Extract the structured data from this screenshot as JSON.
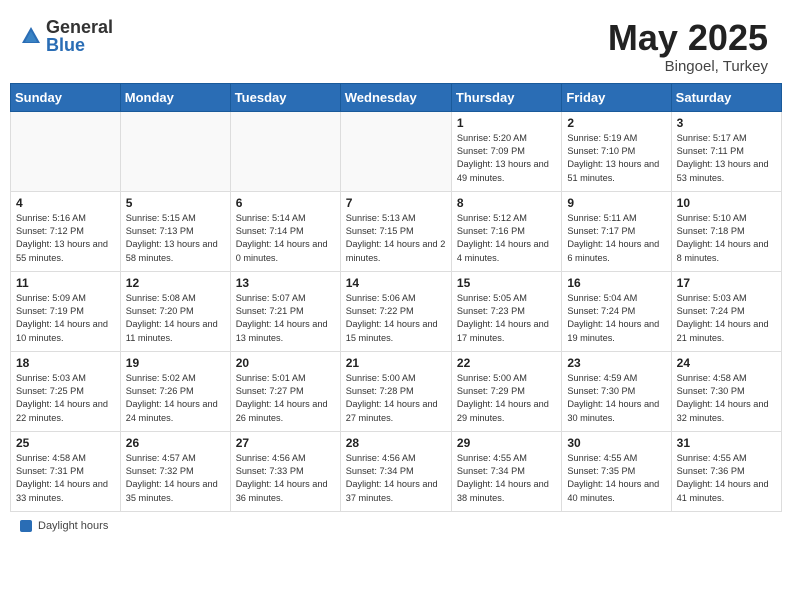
{
  "header": {
    "logo_general": "General",
    "logo_blue": "Blue",
    "month": "May 2025",
    "location": "Bingoel, Turkey"
  },
  "footer": {
    "label": "Daylight hours"
  },
  "days_of_week": [
    "Sunday",
    "Monday",
    "Tuesday",
    "Wednesday",
    "Thursday",
    "Friday",
    "Saturday"
  ],
  "weeks": [
    [
      {
        "num": "",
        "sunrise": "",
        "sunset": "",
        "daylight": ""
      },
      {
        "num": "",
        "sunrise": "",
        "sunset": "",
        "daylight": ""
      },
      {
        "num": "",
        "sunrise": "",
        "sunset": "",
        "daylight": ""
      },
      {
        "num": "",
        "sunrise": "",
        "sunset": "",
        "daylight": ""
      },
      {
        "num": "1",
        "sunrise": "Sunrise: 5:20 AM",
        "sunset": "Sunset: 7:09 PM",
        "daylight": "Daylight: 13 hours and 49 minutes."
      },
      {
        "num": "2",
        "sunrise": "Sunrise: 5:19 AM",
        "sunset": "Sunset: 7:10 PM",
        "daylight": "Daylight: 13 hours and 51 minutes."
      },
      {
        "num": "3",
        "sunrise": "Sunrise: 5:17 AM",
        "sunset": "Sunset: 7:11 PM",
        "daylight": "Daylight: 13 hours and 53 minutes."
      }
    ],
    [
      {
        "num": "4",
        "sunrise": "Sunrise: 5:16 AM",
        "sunset": "Sunset: 7:12 PM",
        "daylight": "Daylight: 13 hours and 55 minutes."
      },
      {
        "num": "5",
        "sunrise": "Sunrise: 5:15 AM",
        "sunset": "Sunset: 7:13 PM",
        "daylight": "Daylight: 13 hours and 58 minutes."
      },
      {
        "num": "6",
        "sunrise": "Sunrise: 5:14 AM",
        "sunset": "Sunset: 7:14 PM",
        "daylight": "Daylight: 14 hours and 0 minutes."
      },
      {
        "num": "7",
        "sunrise": "Sunrise: 5:13 AM",
        "sunset": "Sunset: 7:15 PM",
        "daylight": "Daylight: 14 hours and 2 minutes."
      },
      {
        "num": "8",
        "sunrise": "Sunrise: 5:12 AM",
        "sunset": "Sunset: 7:16 PM",
        "daylight": "Daylight: 14 hours and 4 minutes."
      },
      {
        "num": "9",
        "sunrise": "Sunrise: 5:11 AM",
        "sunset": "Sunset: 7:17 PM",
        "daylight": "Daylight: 14 hours and 6 minutes."
      },
      {
        "num": "10",
        "sunrise": "Sunrise: 5:10 AM",
        "sunset": "Sunset: 7:18 PM",
        "daylight": "Daylight: 14 hours and 8 minutes."
      }
    ],
    [
      {
        "num": "11",
        "sunrise": "Sunrise: 5:09 AM",
        "sunset": "Sunset: 7:19 PM",
        "daylight": "Daylight: 14 hours and 10 minutes."
      },
      {
        "num": "12",
        "sunrise": "Sunrise: 5:08 AM",
        "sunset": "Sunset: 7:20 PM",
        "daylight": "Daylight: 14 hours and 11 minutes."
      },
      {
        "num": "13",
        "sunrise": "Sunrise: 5:07 AM",
        "sunset": "Sunset: 7:21 PM",
        "daylight": "Daylight: 14 hours and 13 minutes."
      },
      {
        "num": "14",
        "sunrise": "Sunrise: 5:06 AM",
        "sunset": "Sunset: 7:22 PM",
        "daylight": "Daylight: 14 hours and 15 minutes."
      },
      {
        "num": "15",
        "sunrise": "Sunrise: 5:05 AM",
        "sunset": "Sunset: 7:23 PM",
        "daylight": "Daylight: 14 hours and 17 minutes."
      },
      {
        "num": "16",
        "sunrise": "Sunrise: 5:04 AM",
        "sunset": "Sunset: 7:24 PM",
        "daylight": "Daylight: 14 hours and 19 minutes."
      },
      {
        "num": "17",
        "sunrise": "Sunrise: 5:03 AM",
        "sunset": "Sunset: 7:24 PM",
        "daylight": "Daylight: 14 hours and 21 minutes."
      }
    ],
    [
      {
        "num": "18",
        "sunrise": "Sunrise: 5:03 AM",
        "sunset": "Sunset: 7:25 PM",
        "daylight": "Daylight: 14 hours and 22 minutes."
      },
      {
        "num": "19",
        "sunrise": "Sunrise: 5:02 AM",
        "sunset": "Sunset: 7:26 PM",
        "daylight": "Daylight: 14 hours and 24 minutes."
      },
      {
        "num": "20",
        "sunrise": "Sunrise: 5:01 AM",
        "sunset": "Sunset: 7:27 PM",
        "daylight": "Daylight: 14 hours and 26 minutes."
      },
      {
        "num": "21",
        "sunrise": "Sunrise: 5:00 AM",
        "sunset": "Sunset: 7:28 PM",
        "daylight": "Daylight: 14 hours and 27 minutes."
      },
      {
        "num": "22",
        "sunrise": "Sunrise: 5:00 AM",
        "sunset": "Sunset: 7:29 PM",
        "daylight": "Daylight: 14 hours and 29 minutes."
      },
      {
        "num": "23",
        "sunrise": "Sunrise: 4:59 AM",
        "sunset": "Sunset: 7:30 PM",
        "daylight": "Daylight: 14 hours and 30 minutes."
      },
      {
        "num": "24",
        "sunrise": "Sunrise: 4:58 AM",
        "sunset": "Sunset: 7:30 PM",
        "daylight": "Daylight: 14 hours and 32 minutes."
      }
    ],
    [
      {
        "num": "25",
        "sunrise": "Sunrise: 4:58 AM",
        "sunset": "Sunset: 7:31 PM",
        "daylight": "Daylight: 14 hours and 33 minutes."
      },
      {
        "num": "26",
        "sunrise": "Sunrise: 4:57 AM",
        "sunset": "Sunset: 7:32 PM",
        "daylight": "Daylight: 14 hours and 35 minutes."
      },
      {
        "num": "27",
        "sunrise": "Sunrise: 4:56 AM",
        "sunset": "Sunset: 7:33 PM",
        "daylight": "Daylight: 14 hours and 36 minutes."
      },
      {
        "num": "28",
        "sunrise": "Sunrise: 4:56 AM",
        "sunset": "Sunset: 7:34 PM",
        "daylight": "Daylight: 14 hours and 37 minutes."
      },
      {
        "num": "29",
        "sunrise": "Sunrise: 4:55 AM",
        "sunset": "Sunset: 7:34 PM",
        "daylight": "Daylight: 14 hours and 38 minutes."
      },
      {
        "num": "30",
        "sunrise": "Sunrise: 4:55 AM",
        "sunset": "Sunset: 7:35 PM",
        "daylight": "Daylight: 14 hours and 40 minutes."
      },
      {
        "num": "31",
        "sunrise": "Sunrise: 4:55 AM",
        "sunset": "Sunset: 7:36 PM",
        "daylight": "Daylight: 14 hours and 41 minutes."
      }
    ]
  ]
}
